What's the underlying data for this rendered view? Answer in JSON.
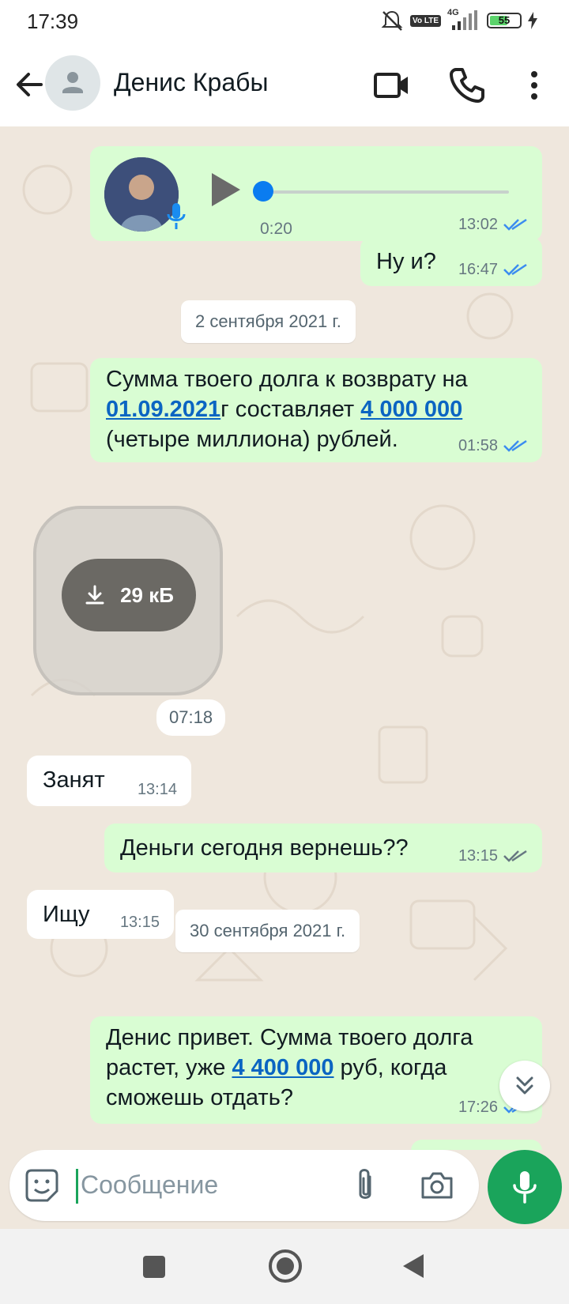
{
  "status_bar": {
    "time": "17:39",
    "volte": "Vo LTE",
    "network": "4G",
    "battery": "55"
  },
  "header": {
    "contact_name": "Денис Крабы",
    "icons": [
      "back-arrow-icon",
      "avatar-placeholder-icon",
      "video-call-icon",
      "phone-icon",
      "more-vert-icon"
    ]
  },
  "messages": [
    {
      "type": "voice",
      "direction": "out",
      "duration": "0:20",
      "time": "13:02",
      "status": "read"
    },
    {
      "type": "text",
      "direction": "out",
      "text": "Ну и?",
      "time": "16:47",
      "status": "read"
    },
    {
      "type": "date",
      "text": "2 сентября 2021 г."
    },
    {
      "type": "text",
      "direction": "out",
      "parts": {
        "p1": "Сумма твоего долга к возврату на ",
        "date_link": "01.09.2021",
        "p2": "г составляет ",
        "amount_link": "4 000 000",
        "p3": "(четыре миллиона) рублей."
      },
      "time": "01:58",
      "status": "read"
    },
    {
      "type": "sticker",
      "direction": "in",
      "size": "29 кБ",
      "time": "07:18"
    },
    {
      "type": "text",
      "direction": "in",
      "text": "Занят",
      "time": "13:14"
    },
    {
      "type": "text",
      "direction": "out",
      "text": "Деньги сегодня вернешь??",
      "time": "13:15",
      "status": "delivered"
    },
    {
      "type": "text",
      "direction": "in",
      "text": "Ищу",
      "time": "13:15"
    },
    {
      "type": "date",
      "text": "30 сентября 2021 г."
    },
    {
      "type": "text",
      "direction": "out",
      "parts": {
        "p1": "Денис привет. Сумма твоего долга растет, уже ",
        "amount_link": "4 400 000",
        "p2": " руб, когда сможешь отдать?"
      },
      "time": "17:26",
      "status": "read"
    }
  ],
  "composer": {
    "placeholder": "Сообщение"
  },
  "colors": {
    "outgoing_bubble": "#d9fdd3",
    "incoming_bubble": "#ffffff",
    "read_ticks": "#53bdeb",
    "accent_green": "#1aa45b",
    "link": "#0b65c2"
  }
}
